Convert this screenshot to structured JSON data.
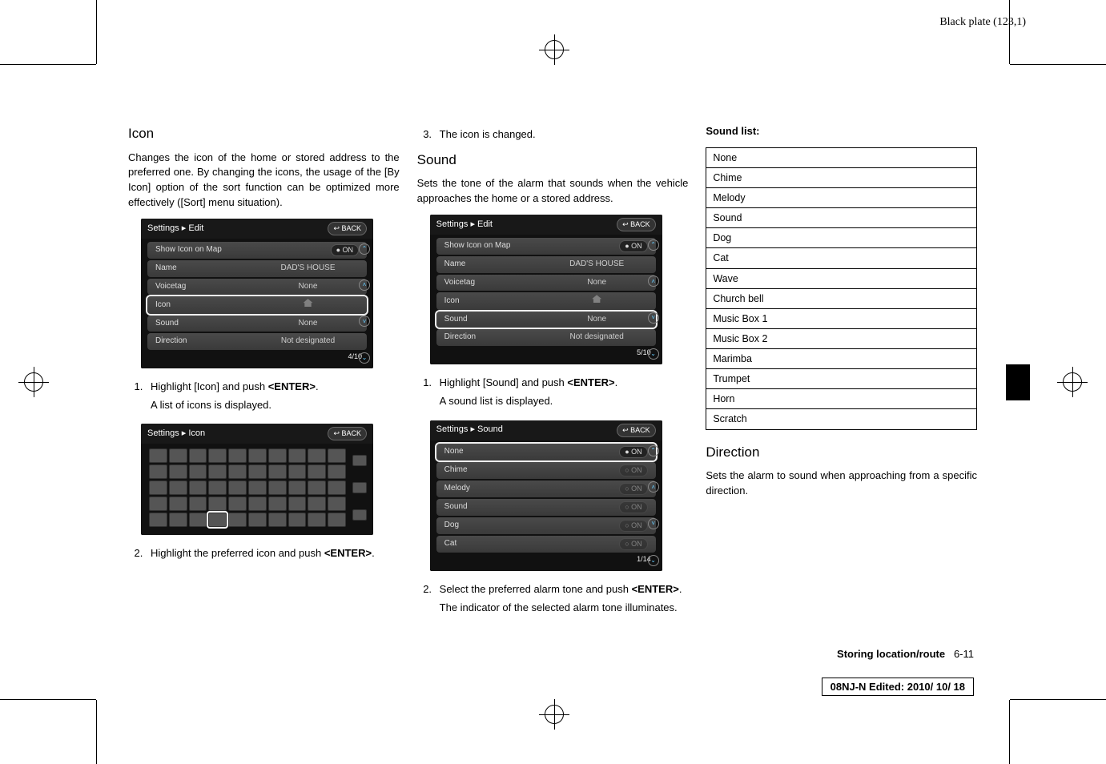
{
  "header": {
    "plate": "Black plate (123,1)"
  },
  "column1": {
    "heading": "Icon",
    "intro": "Changes the icon of the home or stored address to the preferred one. By changing the icons, the usage of the [By Icon] option of the sort function can be optimized more effectively ([Sort] menu situation).",
    "screenshot1": {
      "title": "Settings ▸ Edit",
      "back": "↩ BACK",
      "rows": [
        {
          "label": "Show Icon on Map",
          "value": "",
          "on": "● ON"
        },
        {
          "label": "Name",
          "value": "DAD'S HOUSE"
        },
        {
          "label": "Voicetag",
          "value": "None"
        },
        {
          "label": "Icon",
          "value": "🏠",
          "selected": true
        },
        {
          "label": "Sound",
          "value": "None"
        },
        {
          "label": "Direction",
          "value": "Not designated"
        }
      ],
      "page": "4/10"
    },
    "step1": "Highlight [Icon] and push ",
    "step1b": "<ENTER>",
    "step1c": ".",
    "step1_sub": "A list of icons is displayed.",
    "screenshot2": {
      "title": "Settings ▸ Icon",
      "back": "↩ BACK"
    },
    "step2": "Highlight the preferred icon and push ",
    "step2b": "<ENTER>",
    "step2c": "."
  },
  "column2": {
    "step3": "The icon is changed.",
    "heading_sound": "Sound",
    "intro_sound": "Sets the tone of the alarm that sounds when the vehicle approaches the home or a stored address.",
    "screenshot3": {
      "title": "Settings ▸ Edit",
      "back": "↩ BACK",
      "rows": [
        {
          "label": "Show Icon on Map",
          "value": "",
          "on": "● ON"
        },
        {
          "label": "Name",
          "value": "DAD'S HOUSE"
        },
        {
          "label": "Voicetag",
          "value": "None"
        },
        {
          "label": "Icon",
          "value": "🏠"
        },
        {
          "label": "Sound",
          "value": "None",
          "selected": true
        },
        {
          "label": "Direction",
          "value": "Not designated"
        }
      ],
      "page": "5/10"
    },
    "s_step1": "Highlight [Sound] and push ",
    "s_step1b": "<ENTER>",
    "s_step1c": ".",
    "s_step1_sub": "A sound list is displayed.",
    "screenshot4": {
      "title": "Settings ▸ Sound",
      "back": "↩ BACK",
      "rows": [
        {
          "label": "None",
          "on": "● ON"
        },
        {
          "label": "Chime",
          "on": "○ ON"
        },
        {
          "label": "Melody",
          "on": "○ ON"
        },
        {
          "label": "Sound",
          "on": "○ ON"
        },
        {
          "label": "Dog",
          "on": "○ ON"
        },
        {
          "label": "Cat",
          "on": "○ ON"
        }
      ],
      "page": "1/14"
    },
    "s_step2": "Select the preferred alarm tone and push ",
    "s_step2b": "<ENTER>",
    "s_step2c": ".",
    "s_step2_sub": "The indicator of the selected alarm tone illuminates."
  },
  "column3": {
    "soundlist_heading": "Sound list:",
    "soundlist": [
      "None",
      "Chime",
      "Melody",
      "Sound",
      "Dog",
      "Cat",
      "Wave",
      "Church bell",
      "Music Box 1",
      "Music Box 2",
      "Marimba",
      "Trumpet",
      "Horn",
      "Scratch"
    ],
    "heading_direction": "Direction",
    "direction_text": "Sets the alarm to sound when approaching from a specific direction."
  },
  "footer": {
    "section": "Storing location/route",
    "pagenum": "6-11",
    "edit": "08NJ-N Edited:  2010/ 10/ 18"
  }
}
